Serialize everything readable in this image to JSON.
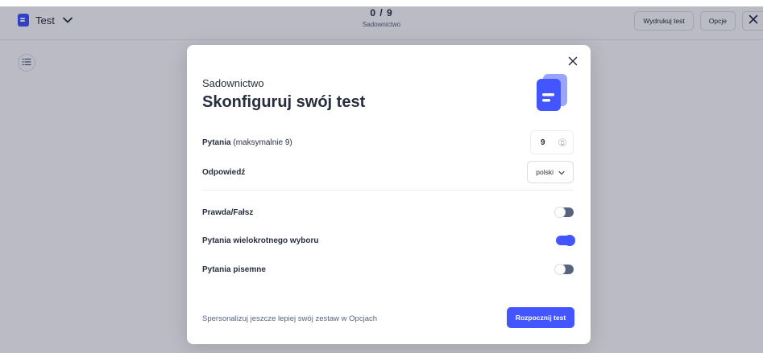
{
  "topbar": {
    "title": "Test",
    "progress": "0 / 9",
    "subtitle": "Sadownictwo",
    "print_label": "Wydrukuj test",
    "options_label": "Opcje"
  },
  "modal": {
    "subtitle": "Sadownictwo",
    "title": "Skonfiguruj swój test",
    "questions": {
      "label": "Pytania",
      "hint": "(maksymalnie 9)",
      "value": "9"
    },
    "answer": {
      "label": "Odpowiedź",
      "selected": "polski"
    },
    "toggles": [
      {
        "label": "Prawda/Fałsz",
        "on": false
      },
      {
        "label": "Pytania wielokrotnego wyboru",
        "on": true
      },
      {
        "label": "Pytania pisemne",
        "on": false
      }
    ],
    "footer_text": "Spersonalizuj jeszcze lepiej swój zestaw w Opcjach",
    "start_label": "Rozpocznij test"
  },
  "colors": {
    "accent": "#4255ff",
    "text": "#282e3e",
    "muted": "#586380",
    "overlay": "rgba(10, 9, 45, 0.28)"
  },
  "icons": {
    "logo": "document-icon",
    "dropdown": "chevron-down-icon",
    "close": "close-icon",
    "list": "list-icon",
    "stepper": "stepper-icon"
  }
}
